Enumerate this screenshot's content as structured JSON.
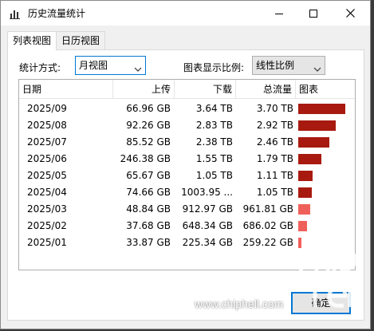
{
  "window": {
    "title": "历史流量统计"
  },
  "tabs": [
    {
      "label": "列表视图",
      "active": true
    },
    {
      "label": "日历视图",
      "active": false
    }
  ],
  "controls": {
    "stat_mode_label": "统计方式:",
    "stat_mode_value": "月视图",
    "chart_scale_label": "图表显示比例:",
    "chart_scale_value": "线性比例"
  },
  "table": {
    "columns": [
      "日期",
      "上传",
      "下载",
      "总流量",
      "图表"
    ],
    "rows": [
      {
        "date": "2025/09",
        "upload": "66.96 GB",
        "download": "3.64 TB",
        "total": "3.70 TB",
        "bar_fraction": 1.0,
        "bar_color": "#a81a0f"
      },
      {
        "date": "2025/08",
        "upload": "92.26 GB",
        "download": "2.83 TB",
        "total": "2.92 TB",
        "bar_fraction": 0.79,
        "bar_color": "#a81a0f"
      },
      {
        "date": "2025/07",
        "upload": "85.52 GB",
        "download": "2.38 TB",
        "total": "2.46 TB",
        "bar_fraction": 0.665,
        "bar_color": "#a81a0f"
      },
      {
        "date": "2025/06",
        "upload": "246.38 GB",
        "download": "1.55 TB",
        "total": "1.79 TB",
        "bar_fraction": 0.484,
        "bar_color": "#a81a0f"
      },
      {
        "date": "2025/05",
        "upload": "65.67 GB",
        "download": "1.05 TB",
        "total": "1.11 TB",
        "bar_fraction": 0.3,
        "bar_color": "#a81a0f"
      },
      {
        "date": "2025/04",
        "upload": "74.66 GB",
        "download": "1003.95 ...",
        "total": "1.05 TB",
        "bar_fraction": 0.284,
        "bar_color": "#a81a0f"
      },
      {
        "date": "2025/03",
        "upload": "48.84 GB",
        "download": "912.97 GB",
        "total": "961.81 GB",
        "bar_fraction": 0.254,
        "bar_color": "#f0605a"
      },
      {
        "date": "2025/02",
        "upload": "37.68 GB",
        "download": "648.34 GB",
        "total": "686.02 GB",
        "bar_fraction": 0.181,
        "bar_color": "#f0605a"
      },
      {
        "date": "2025/01",
        "upload": "33.87 GB",
        "download": "225.34 GB",
        "total": "259.22 GB",
        "bar_fraction": 0.068,
        "bar_color": "#f0605a"
      }
    ]
  },
  "footer": {
    "ok_label": "确定",
    "watermark": "www.chiphell.com"
  }
}
